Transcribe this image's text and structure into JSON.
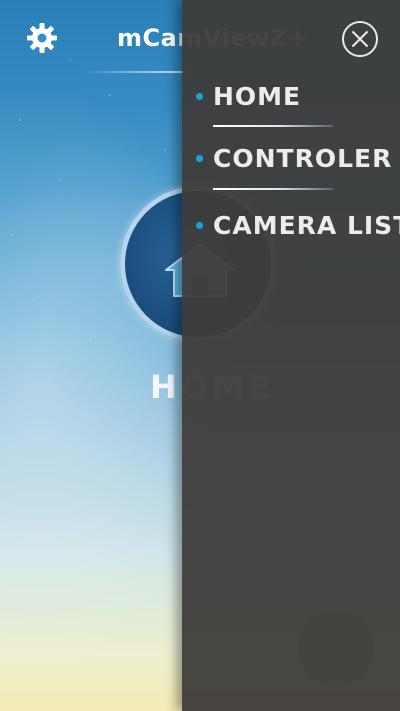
{
  "header": {
    "title": "mCamViewZ+",
    "settings_icon": "gear-icon"
  },
  "home": {
    "label": "HOME",
    "icon": "home-icon"
  },
  "fab": {
    "icon": "plus-icon"
  },
  "drawer": {
    "close_icon": "close-icon",
    "items": [
      {
        "label": "HOME"
      },
      {
        "label": "CONTROLER"
      },
      {
        "label": "CAMERA LIST"
      }
    ]
  },
  "colors": {
    "drawer_bg": "#3e3c3a",
    "accent_dot": "#19a6d6",
    "home_circle": "#1b4f80"
  }
}
